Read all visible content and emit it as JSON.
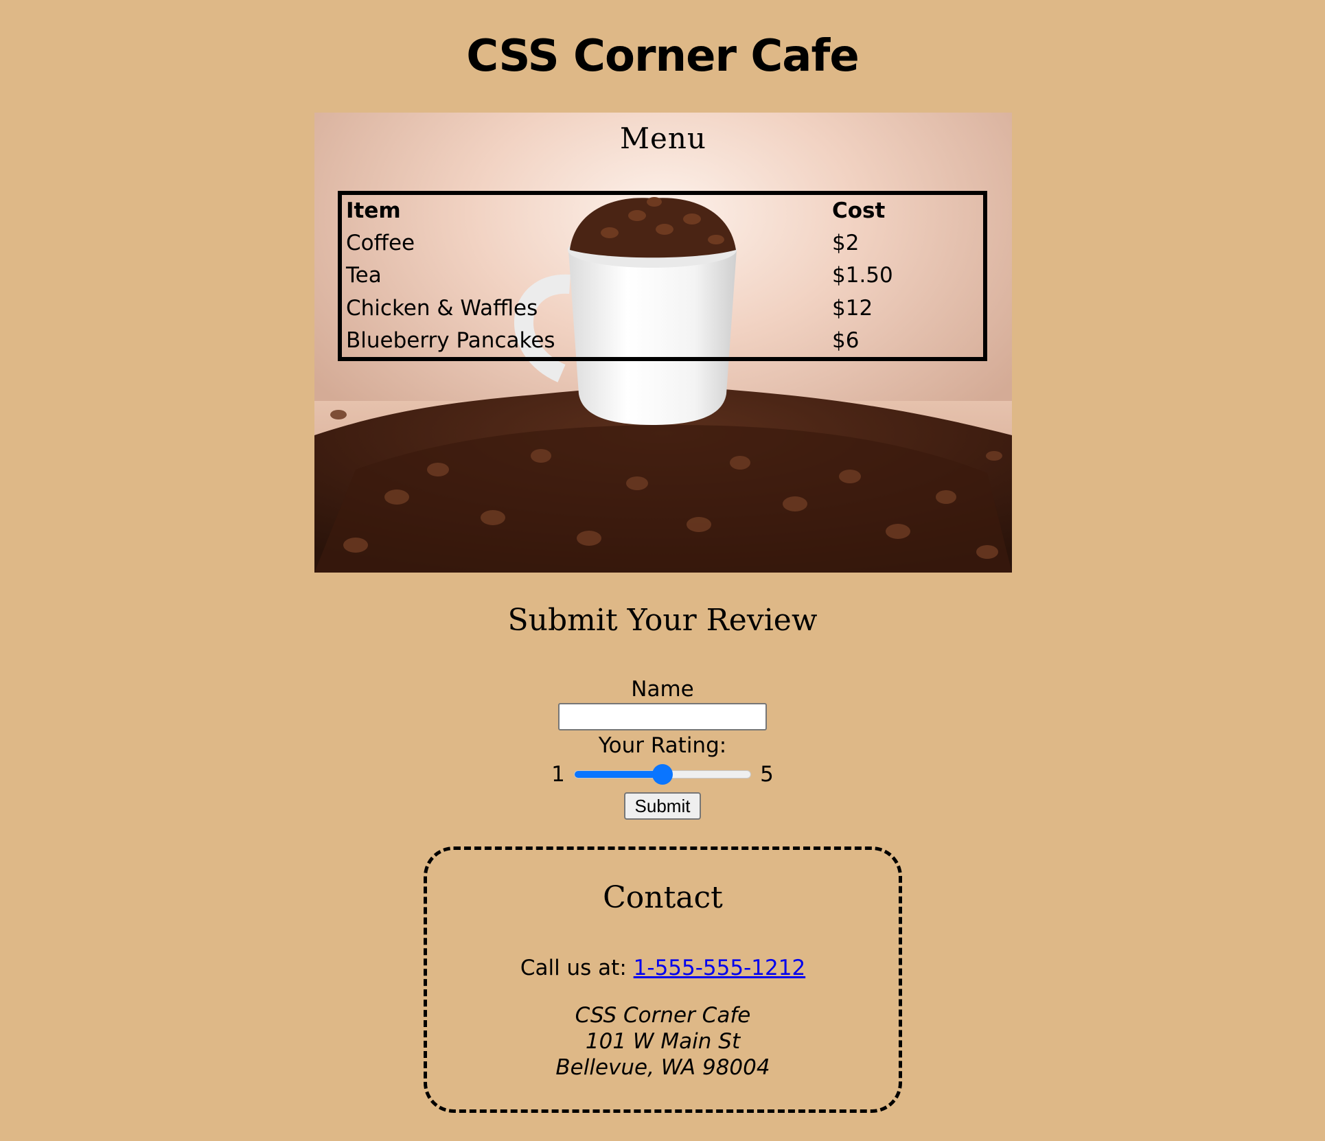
{
  "header": {
    "title": "CSS Corner Cafe"
  },
  "menu": {
    "heading": "Menu",
    "photo": "coffee-cup-with-beans-photo",
    "columns": [
      "Item",
      "Cost"
    ],
    "rows": [
      {
        "item": "Coffee",
        "cost": "$2"
      },
      {
        "item": "Tea",
        "cost": "$1.50"
      },
      {
        "item": "Chicken & Waffles",
        "cost": "$12"
      },
      {
        "item": "Blueberry Pancakes",
        "cost": "$6"
      }
    ]
  },
  "review": {
    "heading": "Submit Your Review",
    "name_label": "Name",
    "name_value": "",
    "rating_label": "Your Rating:",
    "rating_min": "1",
    "rating_max": "5",
    "rating_value": 3,
    "submit_label": "Submit",
    "accent_color": "#0a75ff"
  },
  "contact": {
    "heading": "Contact",
    "call_prefix": "Call us at:",
    "phone": "1-555-555-1212",
    "address_lines": [
      "CSS Corner Cafe",
      "101 W Main St",
      "Bellevue, WA 98004"
    ]
  },
  "colors": {
    "background": "#deb887",
    "link": "#0000ee"
  }
}
